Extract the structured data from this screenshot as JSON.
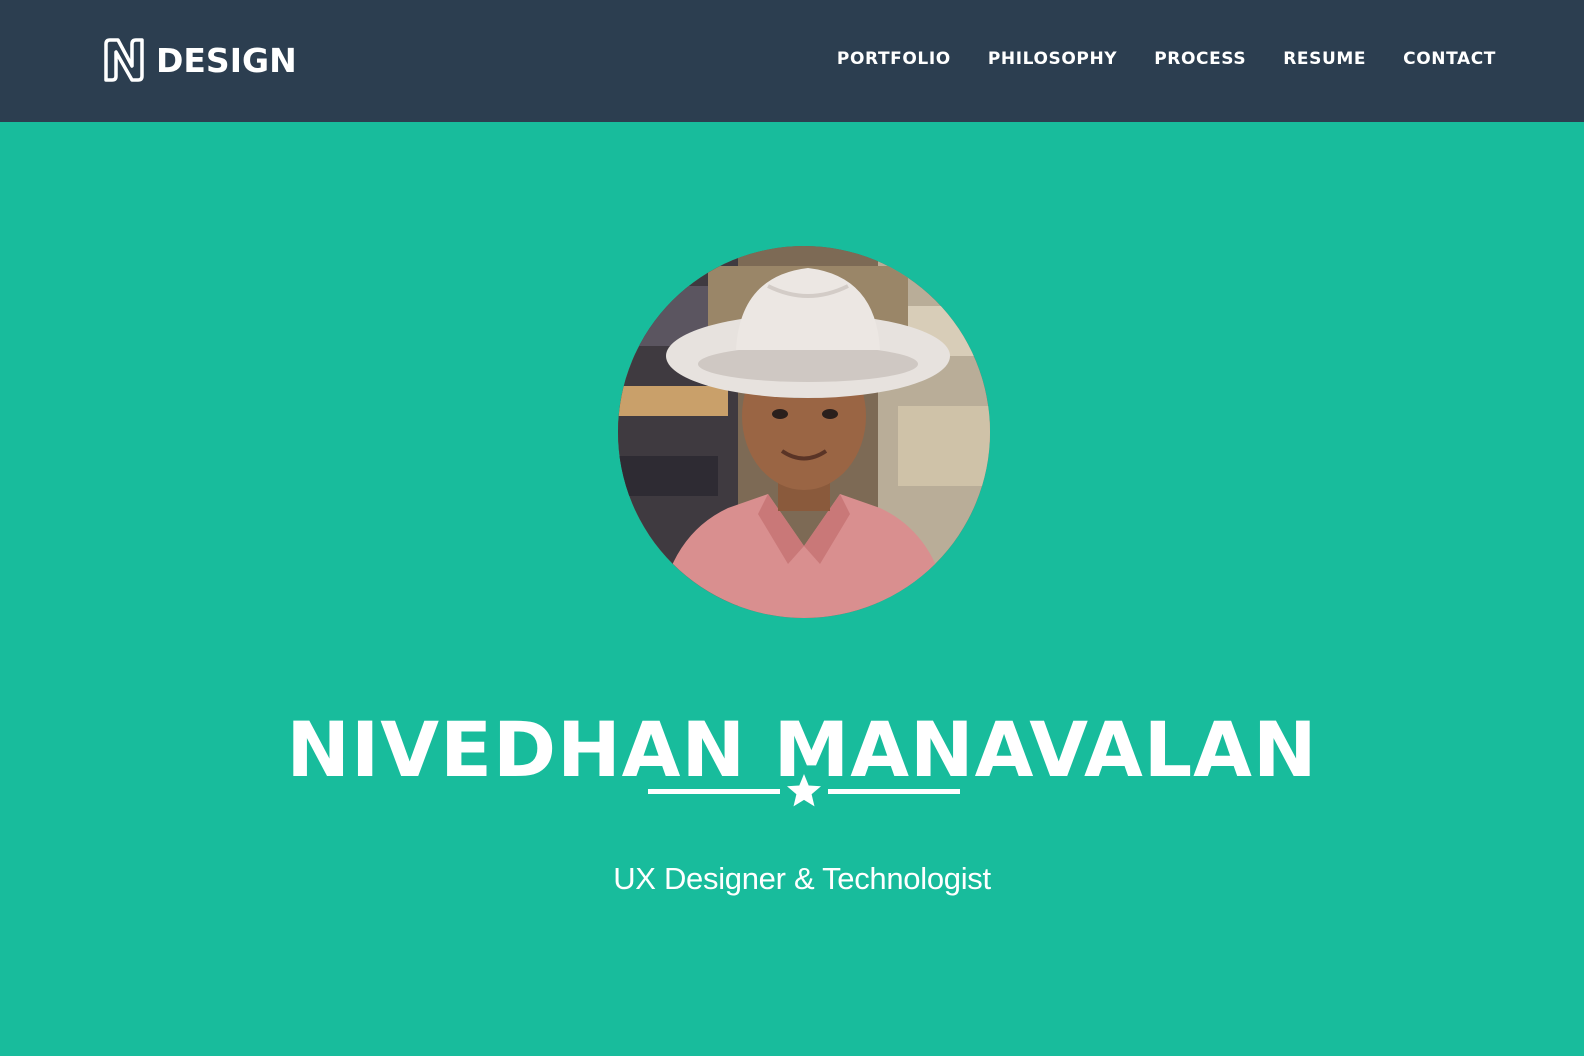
{
  "brand": {
    "name": "DESIGN",
    "logo_icon": "n-monogram-icon"
  },
  "nav": {
    "items": [
      {
        "label": "PORTFOLIO"
      },
      {
        "label": "PHILOSOPHY"
      },
      {
        "label": "PROCESS"
      },
      {
        "label": "RESUME"
      },
      {
        "label": "CONTACT"
      }
    ]
  },
  "hero": {
    "name": "NIVEDHAN MANAVALAN",
    "tagline": "UX Designer & Technologist",
    "divider_icon": "star-icon"
  },
  "colors": {
    "navbar_bg": "#2c3e50",
    "hero_bg": "#18bc9c",
    "text": "#ffffff"
  }
}
